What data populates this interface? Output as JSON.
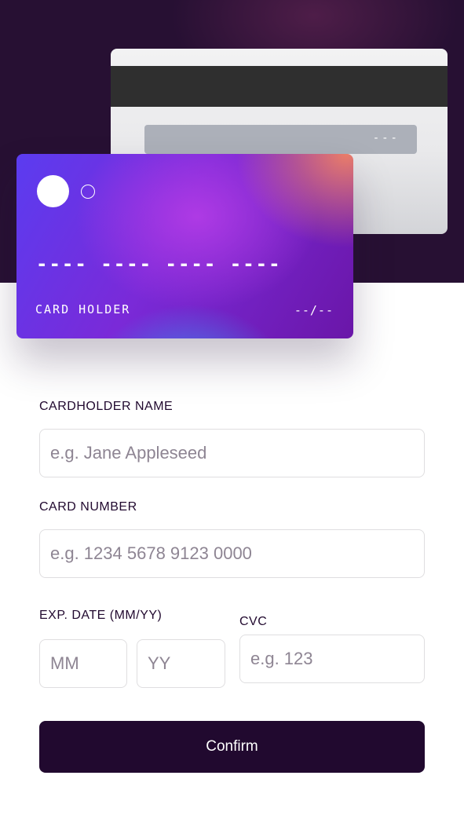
{
  "card_preview": {
    "back": {
      "cvc_value": "---"
    },
    "front": {
      "number": "---- ---- ---- ----",
      "holder": "CARD HOLDER",
      "expiry": "--/--"
    }
  },
  "form": {
    "cardholder_name": {
      "label": "CARDHOLDER NAME",
      "placeholder": "e.g. Jane Appleseed",
      "value": ""
    },
    "card_number": {
      "label": "CARD NUMBER",
      "placeholder": "e.g. 1234 5678 9123 0000",
      "value": ""
    },
    "exp_date": {
      "label": "EXP. DATE (MM/YY)",
      "month_placeholder": "MM",
      "year_placeholder": "YY"
    },
    "cvc": {
      "label": "CVC",
      "placeholder": "e.g. 123",
      "value": ""
    },
    "confirm_label": "Confirm"
  },
  "colors": {
    "hero_background": "#271033",
    "text_primary": "#21092f",
    "button_background": "#21092f",
    "input_border": "#dfdee0",
    "placeholder": "#8e8593"
  }
}
